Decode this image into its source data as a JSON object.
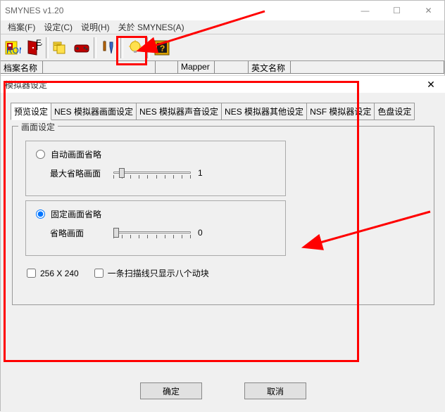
{
  "window": {
    "title": "SMYNES v1.20",
    "controls": {
      "min": "—",
      "max": "☐",
      "close": "✕"
    }
  },
  "menu": {
    "items": [
      "档案(F)",
      "设定(C)",
      "说明(H)",
      "关於 SMYNES(A)"
    ]
  },
  "columns": {
    "c1": "档案名称",
    "c2": "",
    "c3": "",
    "c4": "Mapper",
    "c5": "",
    "c6": "英文名称",
    "c7": ""
  },
  "dialog": {
    "title": "模拟器设定",
    "tabs": [
      "预览设定",
      "NES 模拟器画面设定",
      "NES 模拟器声音设定",
      "NES 模拟器其他设定",
      "NSF 模拟器设定",
      "色盘设定"
    ],
    "active_tab": 0,
    "group": {
      "title": "画面设定"
    },
    "radio1": {
      "label": "自动画面省略",
      "sublabel": "最大省略画面",
      "value": "1"
    },
    "radio2": {
      "label": "固定画面省略",
      "sublabel": "省略画面",
      "value": "0"
    },
    "check1": "256 X 240",
    "check2": "一条扫描线只显示八个动块",
    "buttons": {
      "ok": "确定",
      "cancel": "取消"
    }
  }
}
